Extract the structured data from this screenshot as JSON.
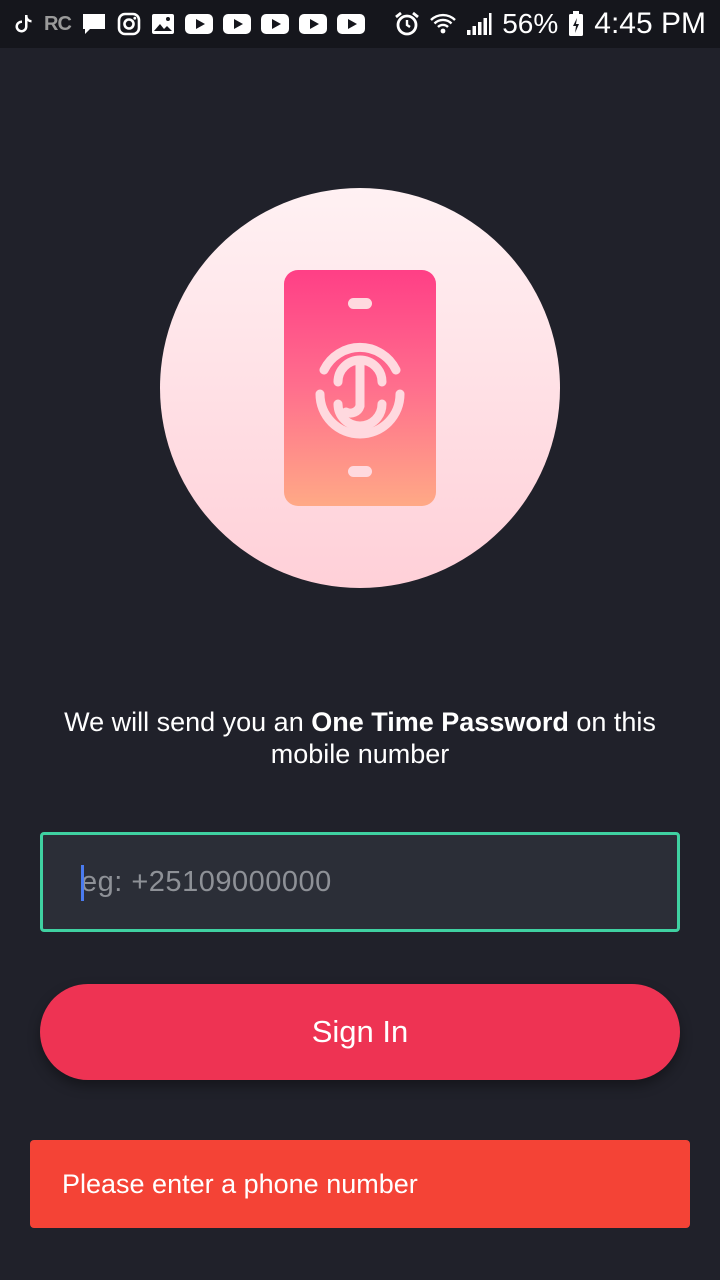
{
  "status_bar": {
    "left_icons": [
      "tiktok-icon",
      "rc-icon",
      "chat-icon",
      "instagram-icon",
      "gallery-icon",
      "youtube-icon",
      "youtube-icon",
      "youtube-icon",
      "youtube-icon",
      "youtube-icon"
    ],
    "rc_label": "RC",
    "battery": "56%",
    "time": "4:45 PM"
  },
  "main": {
    "description_prefix": "We will send you an ",
    "description_bold": "One Time Password",
    "description_suffix": " on this mobile number",
    "phone_input": {
      "placeholder": "eg: +25109000000",
      "value": ""
    },
    "sign_in_label": "Sign In"
  },
  "snackbar": {
    "message": "Please enter a phone number"
  },
  "colors": {
    "background": "#20212a",
    "input_border": "#3fd1a1",
    "button": "#ee3353",
    "snackbar": "#f44336"
  }
}
